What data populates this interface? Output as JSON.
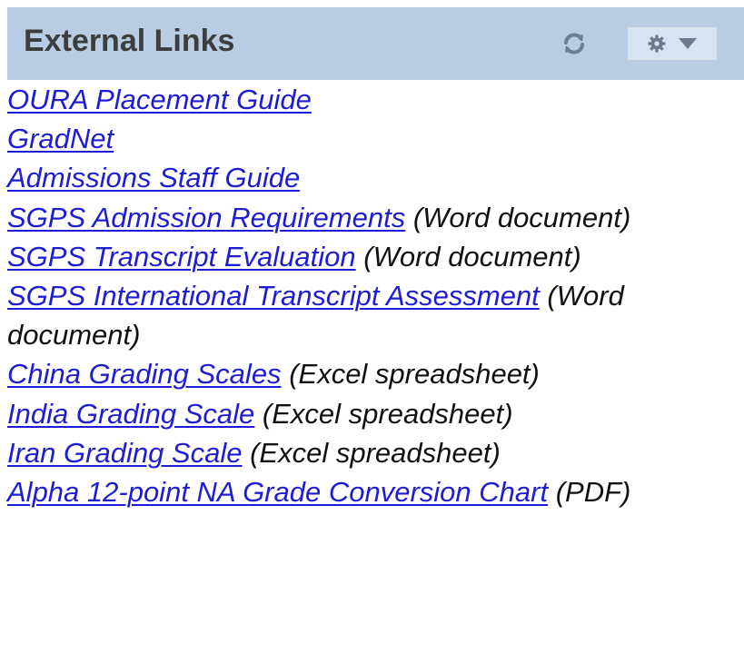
{
  "header": {
    "title": "External Links"
  },
  "icons": {
    "refresh": "refresh-icon",
    "options": "gear-icon",
    "options_menu": "chevron-down-icon"
  },
  "colors": {
    "header_background": "#b8cde4",
    "link": "#1d1dd4"
  },
  "links": [
    {
      "label": "OURA Placement Guide",
      "note": ""
    },
    {
      "label": "GradNet",
      "note": ""
    },
    {
      "label": "Admissions Staff Guide",
      "note": ""
    },
    {
      "label": "SGPS Admission Requirements",
      "note": "(Word document)"
    },
    {
      "label": "SGPS Transcript Evaluation",
      "note": "(Word document)"
    },
    {
      "label": "SGPS International Transcript Assessment",
      "note": "(Word document)"
    },
    {
      "label": "China Grading Scales",
      "note": "(Excel spreadsheet)"
    },
    {
      "label": "India Grading Scale",
      "note": "(Excel spreadsheet)"
    },
    {
      "label": "Iran Grading Scale",
      "note": "(Excel spreadsheet)"
    },
    {
      "label": "Alpha 12-point NA Grade Conversion Chart",
      "note": "(PDF)"
    }
  ]
}
